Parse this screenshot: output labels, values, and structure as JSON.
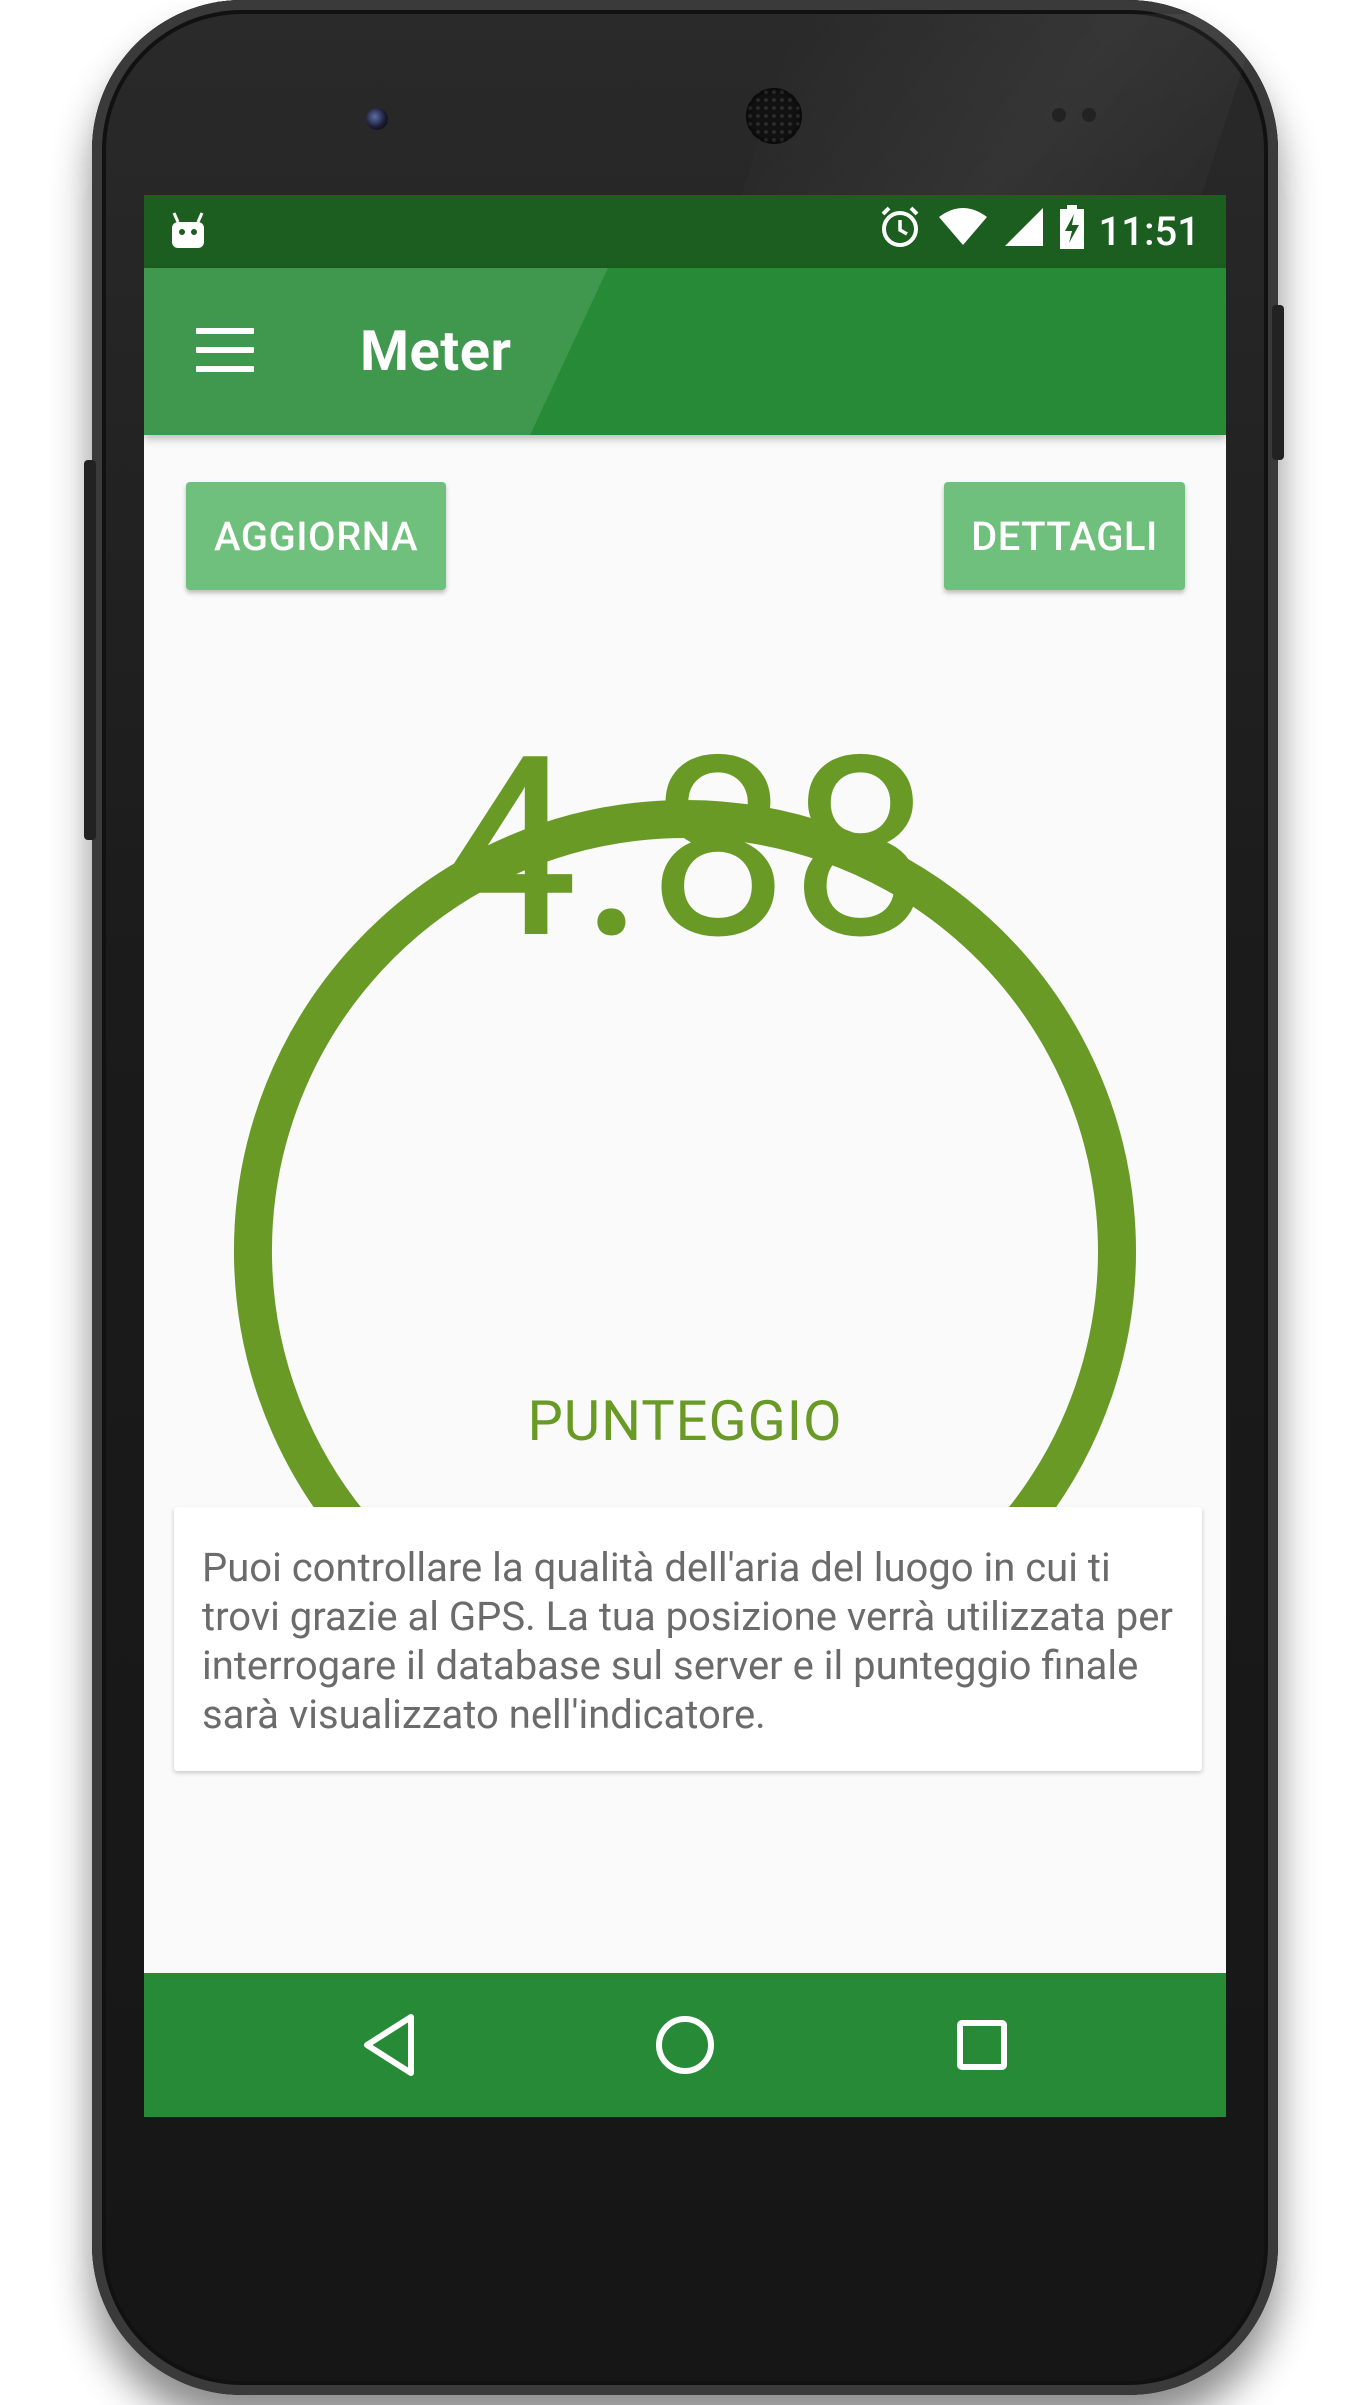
{
  "status_bar": {
    "notification_icon": "android-icon",
    "icons": [
      "alarm-icon",
      "wifi-icon",
      "signal-icon",
      "battery-icon"
    ],
    "time": "11:51"
  },
  "app_bar": {
    "menu_icon": "hamburger-menu-icon",
    "title": "Meter"
  },
  "actions": {
    "update_label": "AGGIORNA",
    "details_label": "DETTAGLI"
  },
  "gauge": {
    "score": "4.88",
    "label": "PUNTEGGIO",
    "fraction": 0.976,
    "color": "#6a9a26",
    "track_color": "#eeeeee"
  },
  "info_card": {
    "text": "Puoi controllare la qualità dell'aria del luogo in cui ti trovi grazie al GPS. La tua posizione verrà utilizzata per interrogare il database sul server e il punteggio finale sarà visualizzato nell'indicatore."
  },
  "nav_bar": {
    "back_icon": "back-triangle-icon",
    "home_icon": "home-circle-icon",
    "recents_icon": "recents-square-icon"
  },
  "colors": {
    "status_bar": "#1b5e20",
    "primary": "#268a36",
    "button": "#6fc07c",
    "accent": "#6a9a26"
  }
}
